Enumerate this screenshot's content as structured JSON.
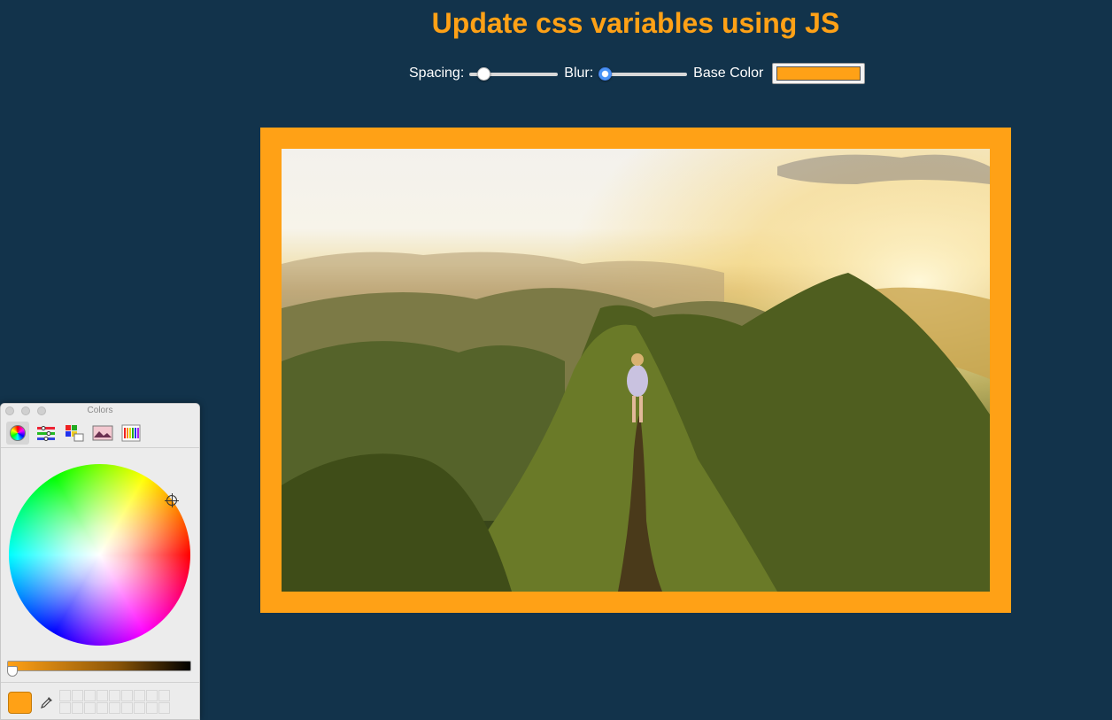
{
  "page": {
    "title": "Update css variables using JS",
    "accent_color": "#ffa116",
    "background_color": "#12334b"
  },
  "controls": {
    "spacing_label": "Spacing:",
    "spacing_value_fraction": 0.1,
    "blur_label": "Blur:",
    "blur_value_fraction": 0.0,
    "base_color_label": "Base Color",
    "base_color_value": "#ffa116"
  },
  "image": {
    "subject": "hiker-on-mountain-ridge",
    "frame_color": "#ffa116"
  },
  "colors_panel": {
    "title": "Colors",
    "toolbar": [
      "color-wheel-icon",
      "sliders-icon",
      "palettes-icon",
      "image-palettes-icon",
      "pencils-icon"
    ],
    "current_color": "#ffa116"
  }
}
